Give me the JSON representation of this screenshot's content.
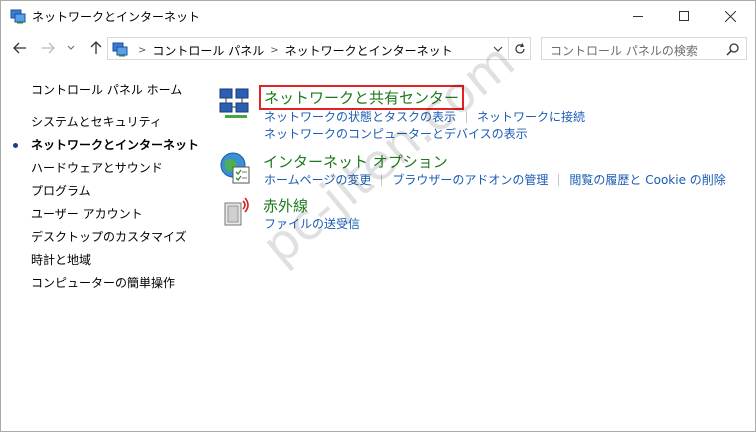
{
  "window": {
    "title": "ネットワークとインターネット"
  },
  "address_bar": {
    "crumbs": [
      "コントロール パネル",
      "ネットワークとインターネット"
    ],
    "search_placeholder": "コントロール パネルの検索"
  },
  "sidebar": {
    "home": "コントロール パネル ホーム",
    "items": [
      {
        "label": "システムとセキュリティ",
        "current": false
      },
      {
        "label": "ネットワークとインターネット",
        "current": true
      },
      {
        "label": "ハードウェアとサウンド",
        "current": false
      },
      {
        "label": "プログラム",
        "current": false
      },
      {
        "label": "ユーザー アカウント",
        "current": false
      },
      {
        "label": "デスクトップのカスタマイズ",
        "current": false
      },
      {
        "label": "時計と地域",
        "current": false
      },
      {
        "label": "コンピューターの簡単操作",
        "current": false
      }
    ]
  },
  "categories": [
    {
      "title": "ネットワークと共有センター",
      "icon": "network-sharing-icon",
      "highlighted": true,
      "links_row1": [
        "ネットワークの状態とタスクの表示",
        "ネットワークに接続"
      ],
      "links_row2": [
        "ネットワークのコンピューターとデバイスの表示"
      ]
    },
    {
      "title": "インターネット オプション",
      "icon": "internet-options-icon",
      "highlighted": false,
      "links_row1": [
        "ホームページの変更",
        "ブラウザーのアドオンの管理",
        "閲覧の履歴と Cookie の削除"
      ]
    },
    {
      "title": "赤外線",
      "icon": "infrared-icon",
      "highlighted": false,
      "links_row1": [
        "ファイルの送受信"
      ]
    }
  ],
  "watermark": "pc-jiten.com",
  "colors": {
    "link": "#1a5bb5",
    "category_title": "#1e7a1e",
    "highlight_border": "#e32222"
  }
}
